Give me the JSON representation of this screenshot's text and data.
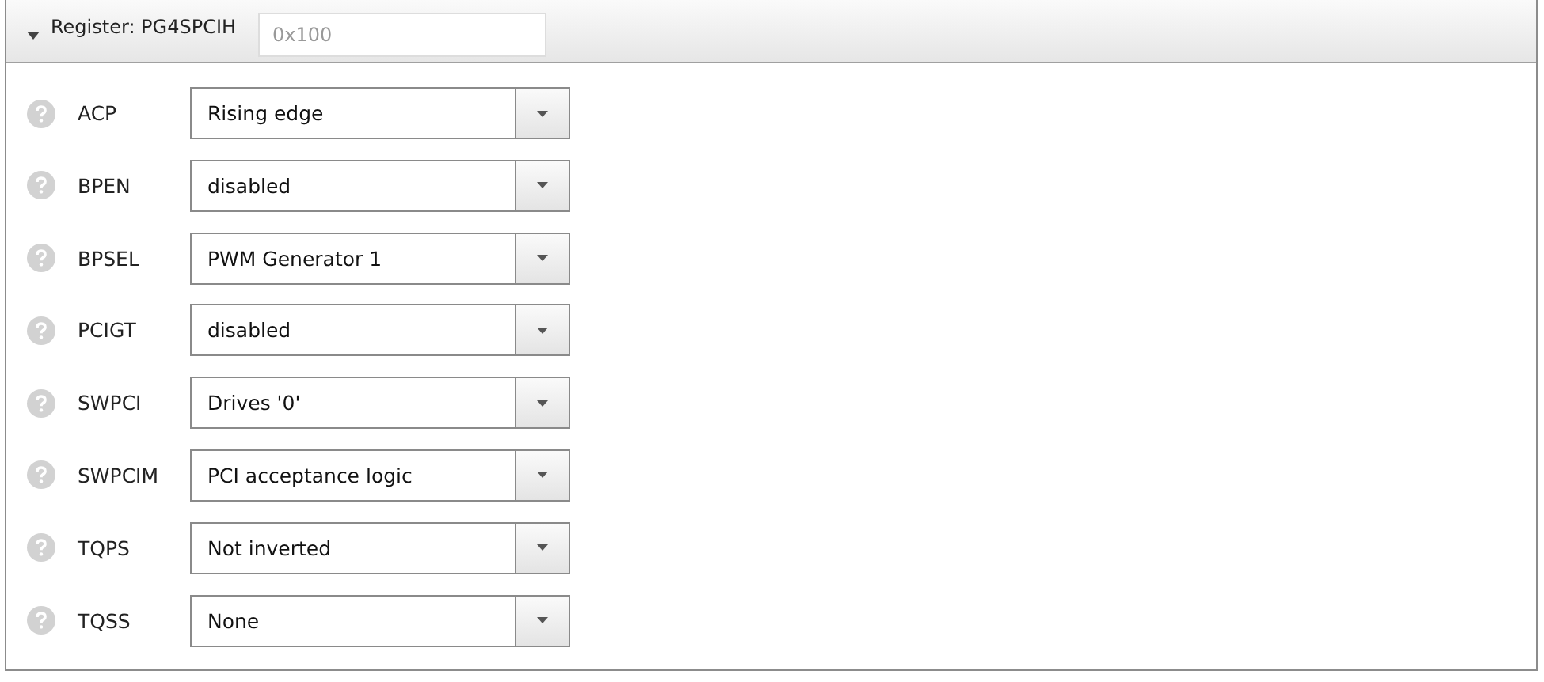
{
  "register": {
    "title": "Register: PG4SPCIH",
    "expanded": true,
    "address_field": {
      "placeholder": "0x100"
    }
  },
  "fields": [
    {
      "name": "ACP",
      "value": "Rising edge"
    },
    {
      "name": "BPEN",
      "value": "disabled"
    },
    {
      "name": "BPSEL",
      "value": "PWM Generator 1"
    },
    {
      "name": "PCIGT",
      "value": "disabled"
    },
    {
      "name": "SWPCI",
      "value": "Drives '0'"
    },
    {
      "name": "SWPCIM",
      "value": "PCI acceptance logic"
    },
    {
      "name": "TQPS",
      "value": "Not inverted"
    },
    {
      "name": "TQSS",
      "value": "None"
    }
  ]
}
